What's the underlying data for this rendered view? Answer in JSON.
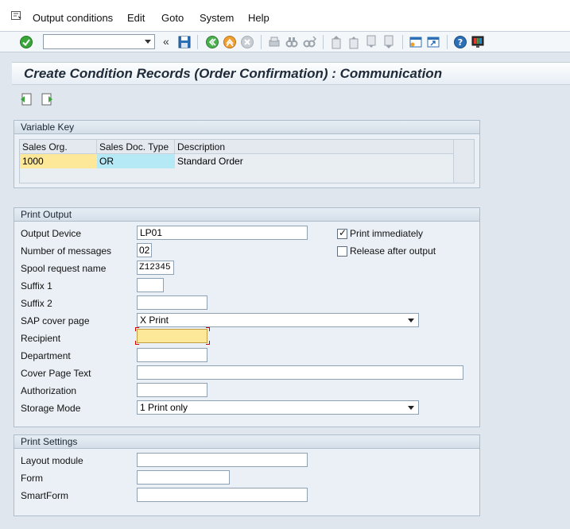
{
  "menu": {
    "items": [
      "Output conditions",
      "Edit",
      "Goto",
      "System",
      "Help"
    ]
  },
  "toolbar": {
    "icons": [
      "enter-icon",
      "back-icon",
      "save-icon",
      "exit-icon",
      "cancel-icon",
      "print-icon",
      "find-icon",
      "find-next-icon",
      "first-page-icon",
      "previous-page-icon",
      "next-page-icon",
      "last-page-icon",
      "new-session-icon",
      "shortcut-icon",
      "help-icon",
      "customize-layout-icon"
    ],
    "collapse_glyph": "«"
  },
  "title": "Create Condition Records (Order Confirmation) : Communication",
  "variable_key": {
    "group_title": "Variable Key",
    "columns": [
      "Sales Org.",
      "Sales Doc. Type",
      "Description"
    ],
    "row": [
      "1000",
      "OR",
      "Standard Order"
    ]
  },
  "print_output": {
    "group_title": "Print Output",
    "fields": {
      "output_device": {
        "label": "Output Device",
        "value": "LP01"
      },
      "num_messages": {
        "label": "Number of messages",
        "value": "02"
      },
      "spool_request": {
        "label": "Spool request name",
        "value": "Z12345"
      },
      "suffix1": {
        "label": "Suffix 1",
        "value": ""
      },
      "suffix2": {
        "label": "Suffix 2",
        "value": ""
      },
      "cover_page": {
        "label": "SAP cover page",
        "value": "X Print"
      },
      "recipient": {
        "label": "Recipient",
        "value": ""
      },
      "department": {
        "label": "Department",
        "value": ""
      },
      "cover_text": {
        "label": "Cover Page Text",
        "value": ""
      },
      "authorization": {
        "label": "Authorization",
        "value": ""
      },
      "storage_mode": {
        "label": "Storage Mode",
        "value": "1 Print only"
      }
    },
    "checkboxes": {
      "print_immediately": {
        "label": "Print immediately",
        "checked": true,
        "mark": "✓"
      },
      "release_after": {
        "label": "Release after output",
        "checked": false,
        "mark": ""
      }
    }
  },
  "print_settings": {
    "group_title": "Print Settings",
    "fields": {
      "layout_module": {
        "label": "Layout module",
        "value": ""
      },
      "form": {
        "label": "Form",
        "value": ""
      },
      "smartform": {
        "label": "SmartForm",
        "value": ""
      }
    }
  },
  "colors": {
    "required_field": "#fde89a",
    "key_field": "#b6e9f6",
    "required_marker": "#d00000"
  }
}
